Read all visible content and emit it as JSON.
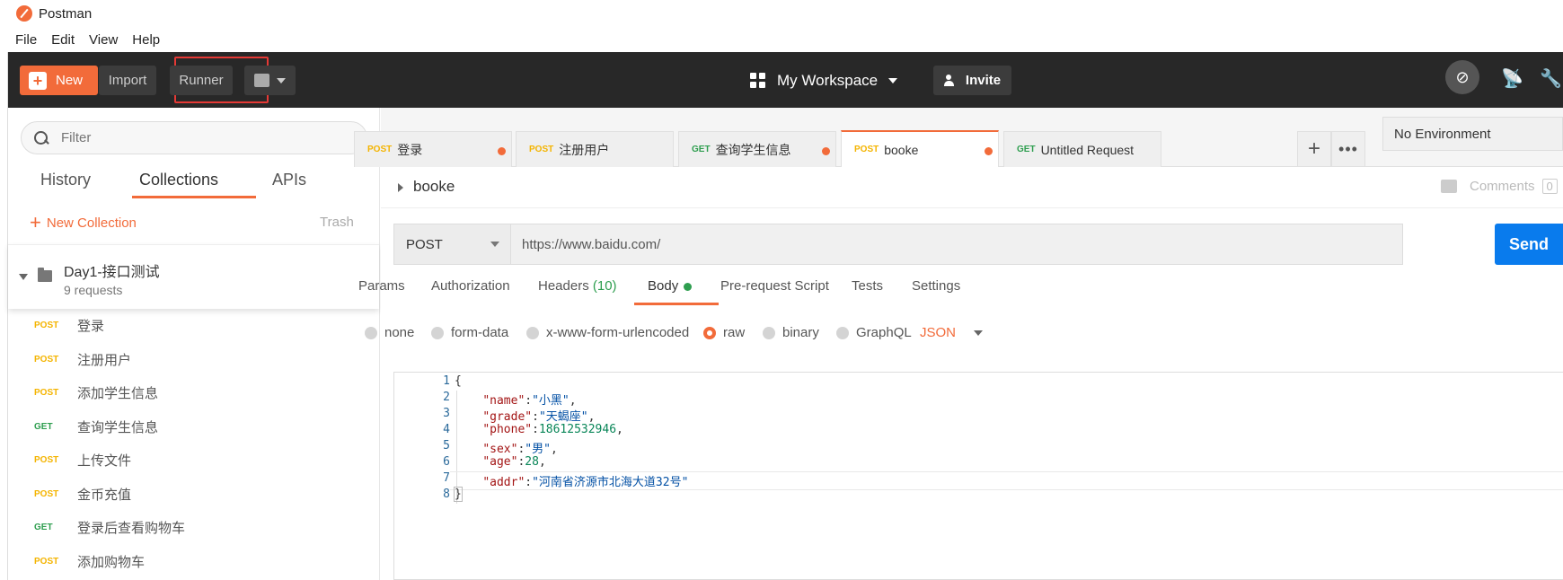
{
  "window": {
    "title": "Postman"
  },
  "menubar": [
    "File",
    "Edit",
    "View",
    "Help"
  ],
  "toolbar": {
    "new_label": "New",
    "import_label": "Import",
    "runner_label": "Runner",
    "workspace_label": "My Workspace",
    "invite_label": "Invite"
  },
  "sidebar": {
    "filter_placeholder": "Filter",
    "tabs": [
      "History",
      "Collections",
      "APIs"
    ],
    "active_tab": "Collections",
    "new_collection_label": "New Collection",
    "trash_label": "Trash",
    "collection": {
      "name": "Day1-接口测试",
      "count": "9 requests"
    },
    "requests": [
      {
        "method": "POST",
        "name": "登录"
      },
      {
        "method": "POST",
        "name": "注册用户"
      },
      {
        "method": "POST",
        "name": "添加学生信息"
      },
      {
        "method": "GET",
        "name": "查询学生信息"
      },
      {
        "method": "POST",
        "name": "上传文件"
      },
      {
        "method": "POST",
        "name": "金币充值"
      },
      {
        "method": "GET",
        "name": "登录后查看购物车"
      },
      {
        "method": "POST",
        "name": "添加购物车"
      }
    ]
  },
  "request_tabs": [
    {
      "method": "POST",
      "name": "登录",
      "unsaved": true
    },
    {
      "method": "POST",
      "name": "注册用户",
      "unsaved": false
    },
    {
      "method": "GET",
      "name": "查询学生信息",
      "unsaved": true
    },
    {
      "method": "POST",
      "name": "booke",
      "unsaved": true,
      "active": true
    },
    {
      "method": "GET",
      "name": "Untitled Request",
      "unsaved": false
    }
  ],
  "environment": {
    "selected": "No Environment"
  },
  "request": {
    "name": "booke",
    "comments_label": "Comments",
    "comments_count": "0",
    "method": "POST",
    "url": "https://www.baidu.com/",
    "send_label": "Send"
  },
  "request_sections": {
    "params": "Params",
    "authorization": "Authorization",
    "headers": "Headers",
    "headers_count": "(10)",
    "body": "Body",
    "pre_request": "Pre-request Script",
    "tests": "Tests",
    "settings": "Settings"
  },
  "body_options": {
    "none": "none",
    "form_data": "form-data",
    "urlencoded": "x-www-form-urlencoded",
    "raw": "raw",
    "binary": "binary",
    "graphql": "GraphQL",
    "format": "JSON",
    "selected": "raw"
  },
  "body_code": {
    "open_brace": "{",
    "close_brace": "}",
    "fields": [
      {
        "key": "\"name\"",
        "value": "\"小黑\"",
        "type": "string"
      },
      {
        "key": "\"grade\"",
        "value": "\"天蝎座\"",
        "type": "string"
      },
      {
        "key": "\"phone\"",
        "value": "18612532946",
        "type": "number"
      },
      {
        "key": "\"sex\"",
        "value": "\"男\"",
        "type": "string"
      },
      {
        "key": "\"age\"",
        "value": "28",
        "type": "number"
      },
      {
        "key": "\"addr\"",
        "value": "\"河南省济源市北海大道32号\"",
        "type": "string"
      }
    ],
    "line_numbers": [
      "1",
      "2",
      "3",
      "4",
      "5",
      "6",
      "7",
      "8"
    ]
  },
  "colors": {
    "accent": "#f26b3a",
    "send": "#097bed",
    "post": "#f4b400",
    "get": "#2e9e4f",
    "highlight": "#e53935"
  }
}
